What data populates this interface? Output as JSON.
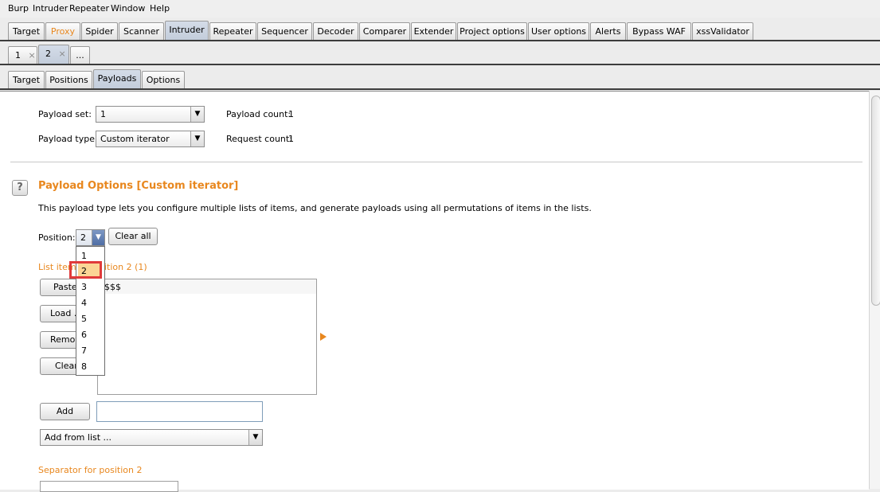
{
  "menu": [
    "Burp",
    "Intruder",
    "Repeater",
    "Window",
    "Help"
  ],
  "main_tabs": [
    "Target",
    "Proxy",
    "Spider",
    "Scanner",
    "Intruder",
    "Repeater",
    "Sequencer",
    "Decoder",
    "Comparer",
    "Extender",
    "Project options",
    "User options",
    "Alerts",
    "Bypass WAF",
    "xssValidator"
  ],
  "attack_tabs": [
    {
      "label": "1",
      "close": "×"
    },
    {
      "label": "2",
      "close": "×"
    },
    {
      "label": "..."
    }
  ],
  "sub_tabs": [
    "Target",
    "Positions",
    "Payloads",
    "Options"
  ],
  "payload_set": {
    "label": "Payload set:",
    "value": "1"
  },
  "payload_type": {
    "label": "Payload type:",
    "value": "Custom iterator"
  },
  "payload_count": {
    "label": "Payload count:",
    "value": "1"
  },
  "request_count": {
    "label": "Request count:",
    "value": "1"
  },
  "help_icon": "?",
  "section": {
    "title": "Payload Options [Custom iterator]",
    "description": "This payload type lets you configure multiple lists of items, and generate payloads using all permutations of items in the lists."
  },
  "position": {
    "label": "Position:",
    "value": "2",
    "clear_all": "Clear all"
  },
  "dropdown": {
    "options": [
      "1",
      "2",
      "3",
      "4",
      "5",
      "6",
      "7",
      "8"
    ],
    "selected": "2"
  },
  "list": {
    "label_left": "List items",
    "label_right": "ition 2 (1)",
    "item_partial": "$$$",
    "btn_paste": "Paste",
    "btn_load": "Load ...",
    "btn_remove": "Remove",
    "btn_clear": "Clear"
  },
  "add": {
    "label": "Add",
    "input_value": ""
  },
  "add_from_list": {
    "value": "Add from list ..."
  },
  "separator": {
    "label": "Separator for position 2"
  },
  "colors": {
    "accent": "#e8871e",
    "highlight": "#e03a3a",
    "selected_bg": "#fbd595"
  }
}
